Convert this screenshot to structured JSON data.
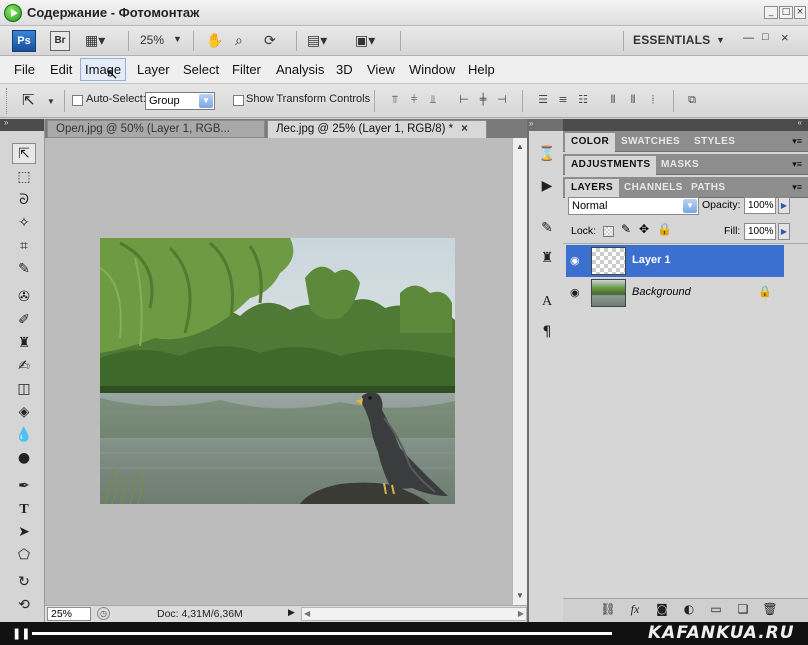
{
  "window": {
    "title": "Содержание - Фотомонтаж"
  },
  "appbar": {
    "ps_label": "Ps",
    "br_label": "Br",
    "zoom": "25%",
    "workspace": "ESSENTIALS"
  },
  "menubar": {
    "items": [
      "File",
      "Edit",
      "Image",
      "Layer",
      "Select",
      "Filter",
      "Analysis",
      "3D",
      "View",
      "Window",
      "Help"
    ]
  },
  "options": {
    "auto_select_label": "Auto-Select:",
    "auto_select_value": "Group",
    "show_transform_label": "Show Transform Controls"
  },
  "documents": {
    "tabs": [
      {
        "label": "Орел.jpg @ 50% (Layer 1, RGB..."
      },
      {
        "label": "Лес.jpg @ 25% (Layer 1, RGB/8) *"
      }
    ],
    "zoom": "25%",
    "doc_info": "Doc: 4,31M/6,36M"
  },
  "panels": {
    "row1": [
      "COLOR",
      "SWATCHES",
      "STYLES"
    ],
    "row2": [
      "ADJUSTMENTS",
      "MASKS"
    ],
    "row3": [
      "LAYERS",
      "CHANNELS",
      "PATHS"
    ],
    "blend_mode": "Normal",
    "opacity_label": "Opacity:",
    "opacity": "100%",
    "lock_label": "Lock:",
    "fill_label": "Fill:",
    "fill": "100%",
    "layers": [
      {
        "name": "Layer 1",
        "selected": true
      },
      {
        "name": "Background",
        "selected": false,
        "locked": true
      }
    ]
  },
  "video": {
    "watermark": "KAFANKUA.RU"
  },
  "colors": {
    "selected_layer": "#3b6fd0",
    "panel_header": "#8d8d8d",
    "canvas_bg": "#bcbcbc"
  }
}
